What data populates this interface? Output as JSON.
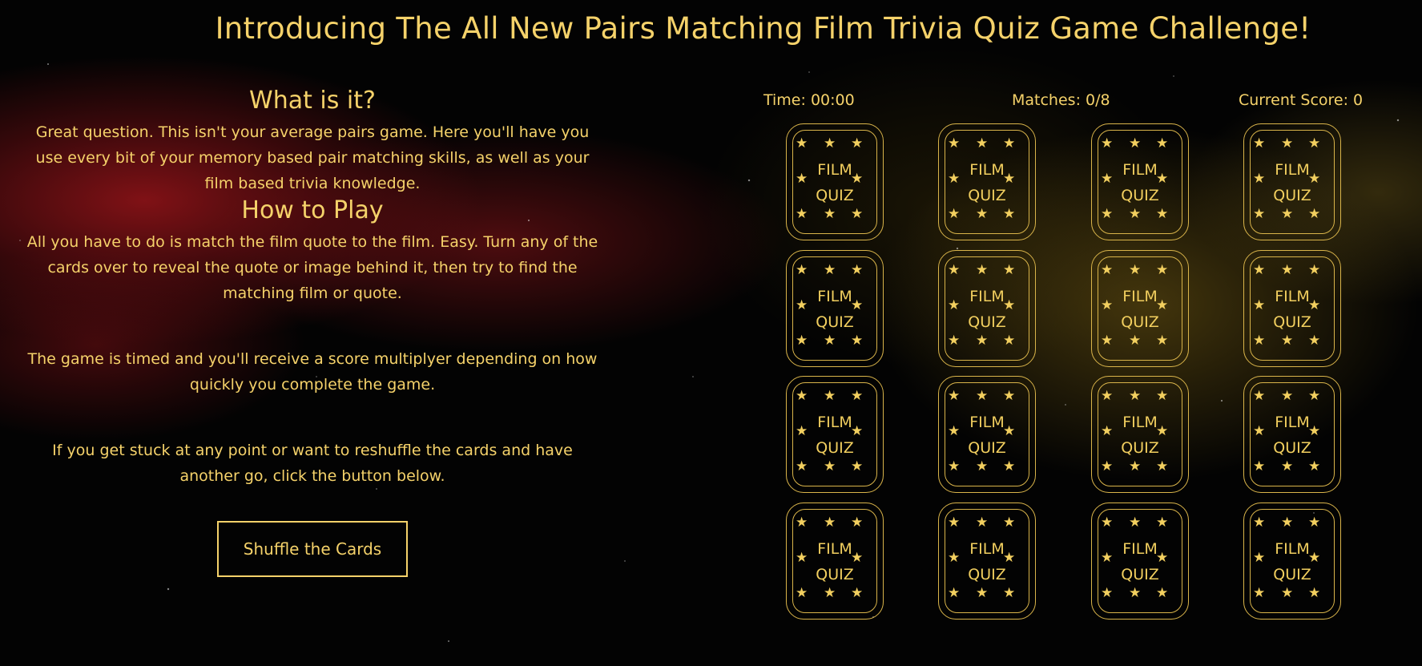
{
  "page": {
    "title": "Introducing The All New Pairs Matching Film Trivia Quiz Game Challenge!"
  },
  "info": {
    "what_heading": "What is it?",
    "what_text": "Great question. This isn't your average pairs game. Here you'll have you use every bit of your memory based pair matching skills, as well as your film based trivia knowledge.",
    "how_heading": "How to Play",
    "how_text_1": "All you have to do is match the film quote to the film. Easy. Turn any of the cards over to reveal the quote or image behind it, then try to find the matching film or quote.",
    "how_text_2": "The game is timed and you'll receive a score multiplyer depending on how quickly you complete the game.",
    "how_text_3": "If you get stuck at any point or want to reshuffle the cards and have another go, click the button below.",
    "shuffle_label": "Shuffle the Cards"
  },
  "stats": {
    "time": "Time: 00:00",
    "matches": "Matches: 0/8",
    "score": "Current Score: 0"
  },
  "card_back": {
    "line1": "FILM",
    "line2": "QUIZ",
    "star": "★"
  },
  "cards": [
    {
      "state": "face-down"
    },
    {
      "state": "face-down"
    },
    {
      "state": "face-down"
    },
    {
      "state": "face-down"
    },
    {
      "state": "face-down"
    },
    {
      "state": "face-down"
    },
    {
      "state": "face-down"
    },
    {
      "state": "face-down"
    },
    {
      "state": "face-down"
    },
    {
      "state": "face-down"
    },
    {
      "state": "face-down"
    },
    {
      "state": "face-down"
    },
    {
      "state": "face-down"
    },
    {
      "state": "face-down"
    },
    {
      "state": "face-down"
    },
    {
      "state": "face-down"
    }
  ],
  "colors": {
    "gold": "#f5d26a",
    "background": "#030303"
  }
}
